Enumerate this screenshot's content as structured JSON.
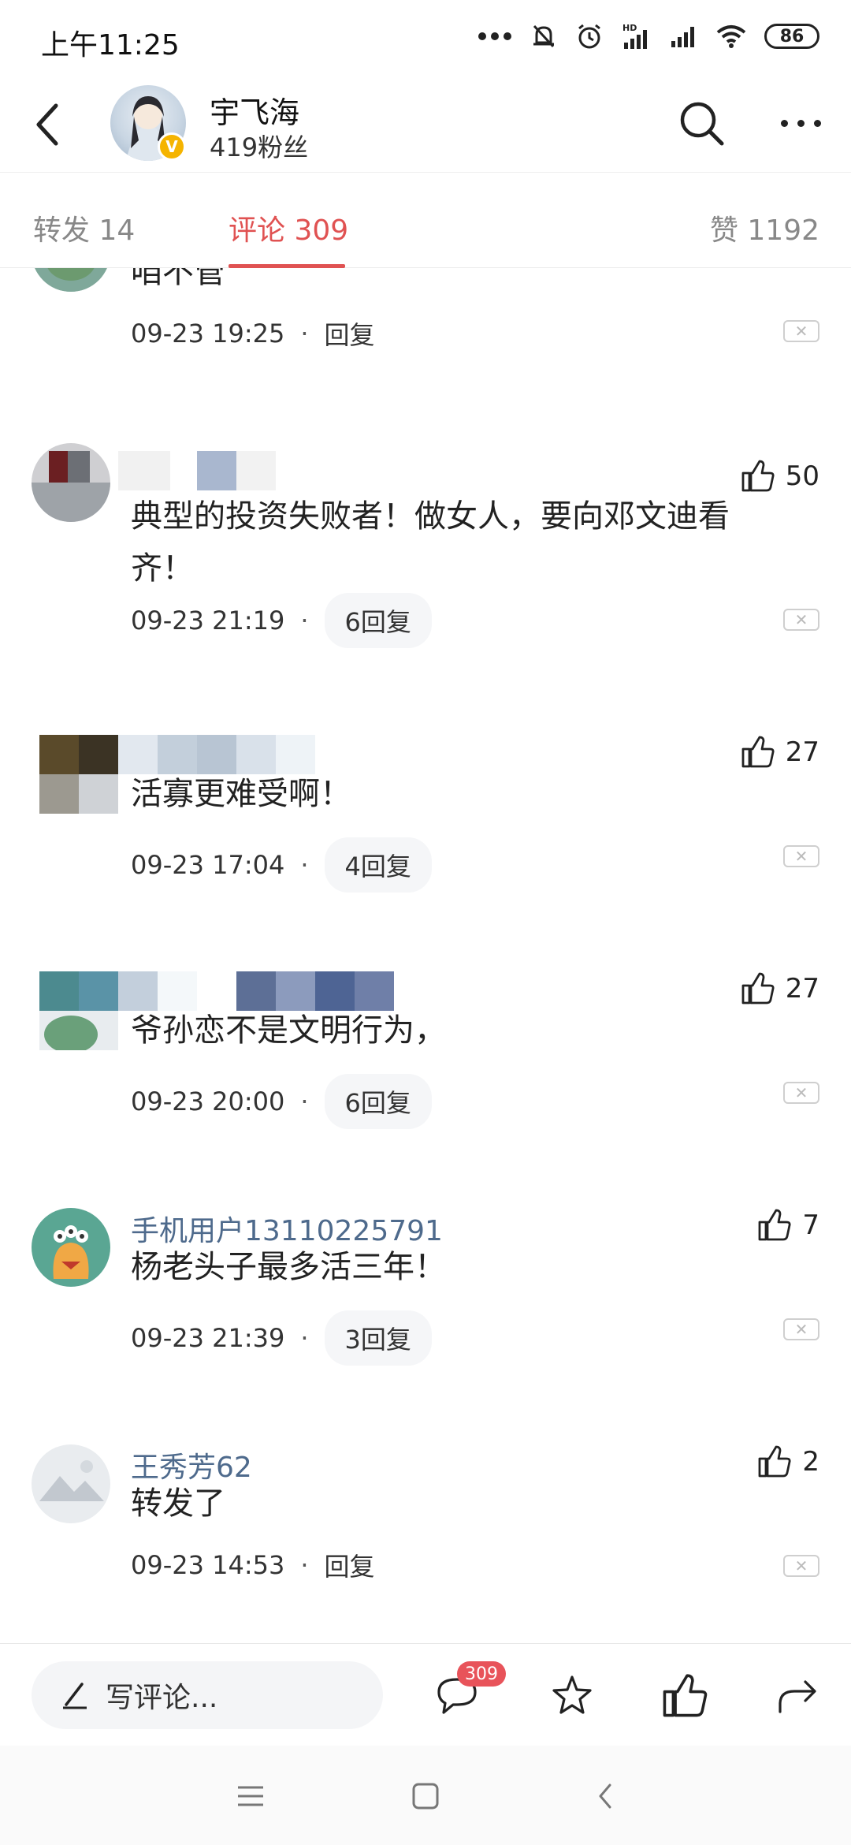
{
  "status_bar": {
    "time": "上午11:25",
    "battery": "86"
  },
  "header": {
    "name": "宇飞海",
    "fans": "419粉丝",
    "verified": "V"
  },
  "tabs": {
    "forward": "转发 14",
    "comments": "评论 309",
    "likes": "赞 1192"
  },
  "comments": [
    {
      "text": "咱不管",
      "time": "09-23 19:25",
      "reply": "回复",
      "likes": ""
    },
    {
      "text": "典型的投资失败者！做女人，要向邓文迪看齐！",
      "time": "09-23 21:19",
      "reply": "6回复",
      "likes": "50"
    },
    {
      "text": "活寡更难受啊！",
      "time": "09-23 17:04",
      "reply": "4回复",
      "likes": "27"
    },
    {
      "text": "爷孙恋不是文明行为，",
      "time": "09-23 20:00",
      "reply": "6回复",
      "likes": "27"
    },
    {
      "name": "手机用户13110225791",
      "text": "杨老头子最多活三年！",
      "time": "09-23 21:39",
      "reply": "3回复",
      "likes": "7"
    },
    {
      "name": "王秀芳62",
      "text": "转发了",
      "time": "09-23 14:53",
      "reply": "回复",
      "likes": "2"
    }
  ],
  "action_bar": {
    "write_placeholder": "写评论...",
    "comment_count": "309"
  },
  "icons": [
    "back-icon",
    "search-icon",
    "more-icon",
    "like-icon",
    "close-icon",
    "pencil-icon",
    "comment-icon",
    "star-icon",
    "share-icon",
    "menu-icon",
    "home-icon",
    "nav-back-icon"
  ],
  "colors": {
    "accent": "#e05252",
    "username": "#4e6a8c",
    "badge": "#e8535a"
  }
}
